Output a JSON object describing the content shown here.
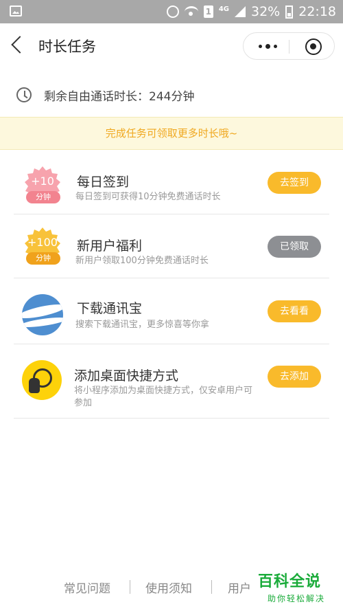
{
  "status_bar": {
    "network": "4G",
    "sim": "1",
    "battery": "32%",
    "time": "22:18"
  },
  "nav": {
    "title": "时长任务"
  },
  "remaining": {
    "text": "剩余自由通话时长：244分钟"
  },
  "banner": {
    "text": "完成任务可领取更多时长哦~"
  },
  "tasks": [
    {
      "badge_value": "+10",
      "badge_tag": "分钟",
      "name": "每日签到",
      "desc": "每日签到可获得10分钟免费通话时长",
      "button": "去签到",
      "button_state": "active"
    },
    {
      "badge_value": "+100",
      "badge_tag": "分钟",
      "name": "新用户福利",
      "desc": "新用户领取100分钟免费通话时长",
      "button": "已领取",
      "button_state": "done"
    },
    {
      "name": "下载通讯宝",
      "desc": "搜索下载通讯宝，更多惊喜等你拿",
      "button": "去看看",
      "button_state": "active"
    },
    {
      "name": "添加桌面快捷方式",
      "desc": "将小程序添加为桌面快捷方式，仅安卓用户可参加",
      "button": "去添加",
      "button_state": "active"
    }
  ],
  "footer": {
    "links": [
      "常见问题",
      "使用须知",
      "用户"
    ]
  },
  "watermark": {
    "title": "百科全说",
    "subtitle": "助你轻松解决"
  },
  "colors": {
    "accent_orange": "#f9ba2b",
    "done_gray": "#8d8f93",
    "banner_bg": "#fdf8dd",
    "banner_text": "#f0a820",
    "watermark_green": "#1aab3a"
  }
}
